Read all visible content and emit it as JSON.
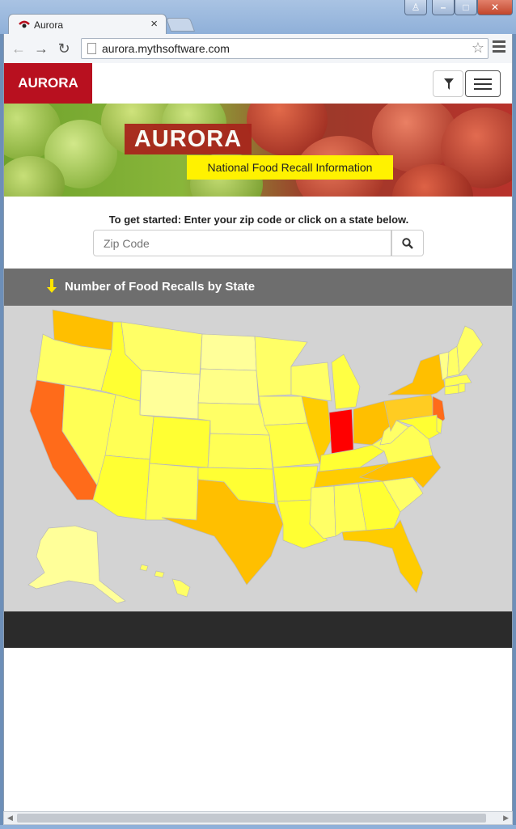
{
  "browser": {
    "tab_title": "Aurora",
    "url": "aurora.mythsoftware.com"
  },
  "site": {
    "brand": "AURORA",
    "hero_title": "AURORA",
    "hero_subtitle": "National Food Recall Information",
    "prompt": "To get started: Enter your zip code or click on a state below.",
    "zip_placeholder": "Zip Code",
    "map_heading": "Number of Food Recalls by State"
  },
  "colors": {
    "brand_red": "#b8101f",
    "recall_highest": "#ff0000",
    "recall_high": "#ff6b1a",
    "recall_medium": "#ffbf00",
    "recall_low": "#ffff33",
    "recall_lowest": "#ffff99"
  },
  "icons": [
    "filter-icon",
    "menu-icon",
    "search-icon",
    "arrow-down-icon",
    "back-icon",
    "forward-icon",
    "reload-icon",
    "star-icon"
  ]
}
